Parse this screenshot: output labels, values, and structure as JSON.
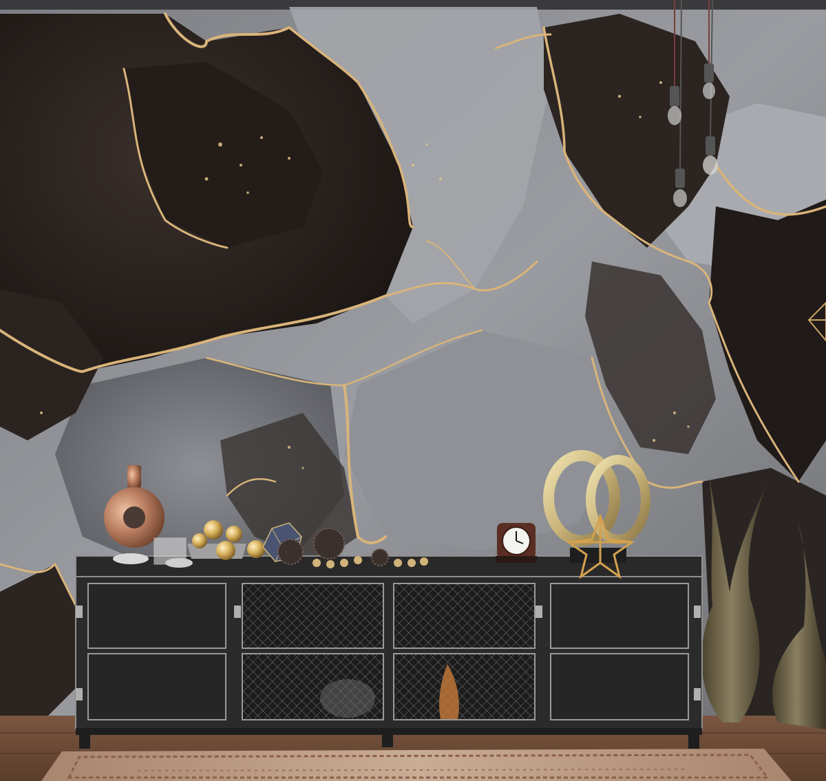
{
  "scene": {
    "kind": "interior-photo",
    "colors": {
      "wall_light": "#9a9ca1",
      "wall_mid": "#6e6f73",
      "marble_dark": "#2b2421",
      "marble_darker": "#1a1513",
      "gold_vein": "#d9b47a",
      "cabinet": "#2c2b2b",
      "cabinet_edge": "#8f8f8f",
      "floor": "#6b4a34",
      "rug": "#b89882",
      "vase": "#6f6549",
      "brass": "#c9b47a",
      "copper": "#b97d5f"
    },
    "objects": [
      "gray-black-marble-wall-mural",
      "gold-veins",
      "industrial-metal-sideboard",
      "mesh-cabinet-doors",
      "copper-ring-vase",
      "gold-spheres-bowl",
      "geometric-polyhedron",
      "wicker-ball",
      "table-clock",
      "gold-interlocking-rings-sculpture",
      "gold-star-ornament",
      "tall-bronze-vases",
      "pendant-bulbs",
      "wooden-floor",
      "patterned-rug"
    ],
    "clock": {
      "face": "analog"
    }
  }
}
